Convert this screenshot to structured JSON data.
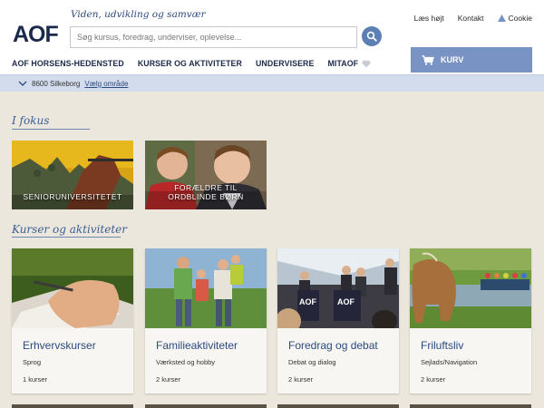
{
  "header": {
    "logo": "AOF",
    "tagline": "Viden, udvikling og samvær",
    "search": {
      "placeholder": "Søg kursus, foredrag, underviser, oplevelse..."
    },
    "top_links": [
      "Læs højt",
      "Kontakt",
      "Cookie"
    ],
    "nav": [
      "AOF HORSENS-HEDENSTED",
      "KURSER OG AKTIVITETER",
      "UNDERVISERE",
      "MITAOF"
    ],
    "cart_label": "KURV"
  },
  "location": {
    "text": "8600 Silkeborg",
    "link": "Vælg område"
  },
  "focus": {
    "title": "I fokus",
    "tiles": [
      {
        "caption": "SENIORUNIVERSITETET"
      },
      {
        "caption": "FORÆLDRE TIL\nORDBLINDE BØRN"
      }
    ]
  },
  "courses": {
    "title": "Kurser og aktiviteter",
    "cards": [
      {
        "title": "Erhvervskurser",
        "sub": "Sprog",
        "count": "1 kurser"
      },
      {
        "title": "Familieaktiviteter",
        "sub": "Værksted og hobby",
        "count": "2 kurser"
      },
      {
        "title": "Foredrag og debat",
        "sub": "Debat og dialog",
        "count": "2 kurser"
      },
      {
        "title": "Friluftsliv",
        "sub": "Sejlads/Navigation",
        "count": "2 kurser"
      }
    ]
  },
  "colors": {
    "brand": "#1b2a4a",
    "accent": "#5c7fb4",
    "cart": "#7a93c5",
    "link": "#2c4a7e"
  }
}
